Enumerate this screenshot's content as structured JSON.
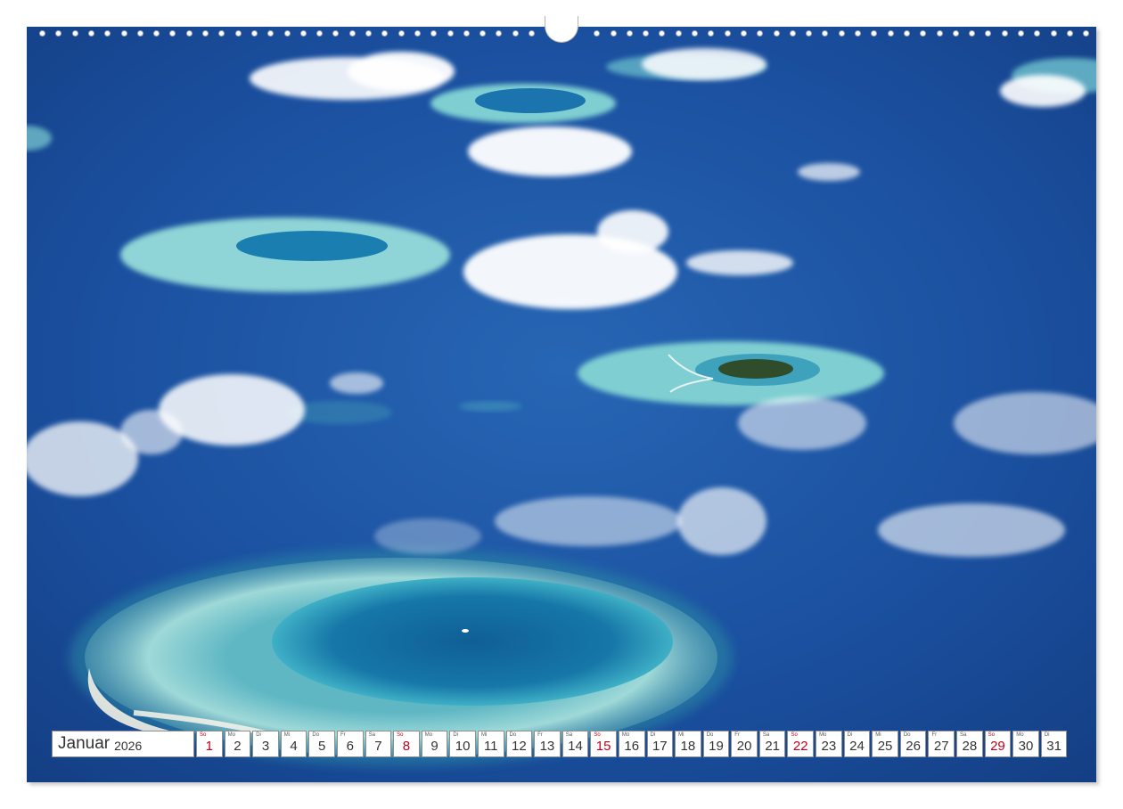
{
  "photo": {
    "description_icon": "maldives-atolls-photo"
  },
  "calendar": {
    "month": "Januar",
    "year": "2026",
    "days": [
      {
        "dn": "So",
        "num": "1",
        "sunday": true
      },
      {
        "dn": "Mo",
        "num": "2",
        "sunday": false
      },
      {
        "dn": "Di",
        "num": "3",
        "sunday": false
      },
      {
        "dn": "Mi",
        "num": "4",
        "sunday": false
      },
      {
        "dn": "Do",
        "num": "5",
        "sunday": false
      },
      {
        "dn": "Fr",
        "num": "6",
        "sunday": false
      },
      {
        "dn": "Sa",
        "num": "7",
        "sunday": false
      },
      {
        "dn": "So",
        "num": "8",
        "sunday": true
      },
      {
        "dn": "Mo",
        "num": "9",
        "sunday": false
      },
      {
        "dn": "Di",
        "num": "10",
        "sunday": false
      },
      {
        "dn": "Mi",
        "num": "11",
        "sunday": false
      },
      {
        "dn": "Do",
        "num": "12",
        "sunday": false
      },
      {
        "dn": "Fr",
        "num": "13",
        "sunday": false
      },
      {
        "dn": "Sa",
        "num": "14",
        "sunday": false
      },
      {
        "dn": "So",
        "num": "15",
        "sunday": true
      },
      {
        "dn": "Mo",
        "num": "16",
        "sunday": false
      },
      {
        "dn": "Di",
        "num": "17",
        "sunday": false
      },
      {
        "dn": "Mi",
        "num": "18",
        "sunday": false
      },
      {
        "dn": "Do",
        "num": "19",
        "sunday": false
      },
      {
        "dn": "Fr",
        "num": "20",
        "sunday": false
      },
      {
        "dn": "Sa",
        "num": "21",
        "sunday": false
      },
      {
        "dn": "So",
        "num": "22",
        "sunday": true
      },
      {
        "dn": "Mo",
        "num": "23",
        "sunday": false
      },
      {
        "dn": "Di",
        "num": "24",
        "sunday": false
      },
      {
        "dn": "Mi",
        "num": "25",
        "sunday": false
      },
      {
        "dn": "Do",
        "num": "26",
        "sunday": false
      },
      {
        "dn": "Fr",
        "num": "27",
        "sunday": false
      },
      {
        "dn": "Sa",
        "num": "28",
        "sunday": false
      },
      {
        "dn": "So",
        "num": "29",
        "sunday": true
      },
      {
        "dn": "Mo",
        "num": "30",
        "sunday": false
      },
      {
        "dn": "Di",
        "num": "31",
        "sunday": false
      }
    ]
  },
  "colors": {
    "sunday": "#c0001a",
    "ocean": "#1b4c9a",
    "lagoon": "#7fd3d6"
  }
}
